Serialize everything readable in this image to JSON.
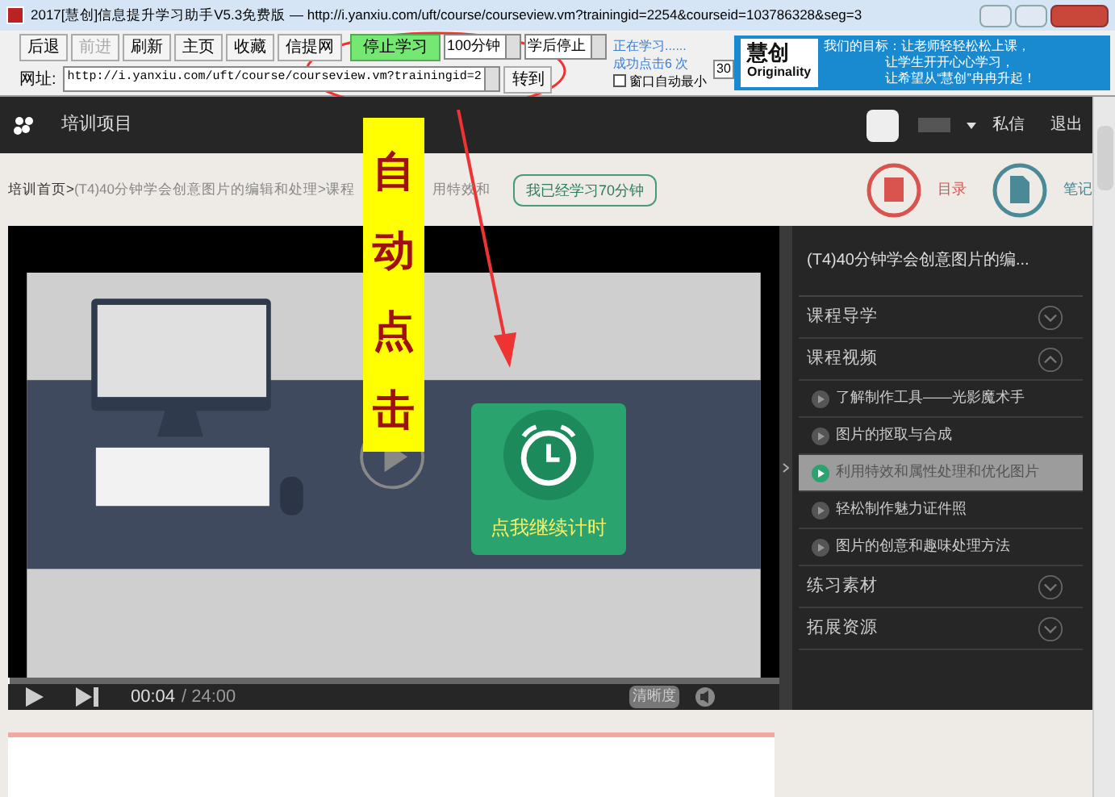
{
  "window": {
    "title": "2017[慧创]信息提升学习助手V5.3免费版 — http://i.yanxiu.com/uft/course/courseview.vm?trainingid=2254&courseid=103786328&seg=3"
  },
  "toolbar": {
    "buttons": [
      {
        "label": "后退",
        "disabled": false
      },
      {
        "label": "前进",
        "disabled": true
      },
      {
        "label": "刷新",
        "disabled": false
      },
      {
        "label": "主页",
        "disabled": false
      },
      {
        "label": "收藏",
        "disabled": false
      },
      {
        "label": "信提网",
        "disabled": false
      }
    ],
    "stop_button": "停止学习",
    "duration_select": "100分钟",
    "after_select": "学后停止",
    "status_lines": [
      "正在学习......",
      "成功点击6 次"
    ],
    "auto_minimize": {
      "label": "窗口自动最小",
      "checked": false
    },
    "interval": "30",
    "address_label": "网址:",
    "address": "http://i.yanxiu.com/uft/course/courseview.vm?trainingid=2",
    "go_button": "转到"
  },
  "banner": {
    "logo": "慧创",
    "logo_sub": "Originality",
    "slogan": [
      "我们的目标：让老师轻轻松松上课，",
      "让学生开开心心学习，",
      "让希望从“慧创”冉冉升起！"
    ]
  },
  "site_header": {
    "title": "培训项目",
    "links": [
      "私信",
      "退出"
    ]
  },
  "breadcrumb": [
    "培训首页>",
    "(T4)40分钟学会创意图片的编辑和处理>",
    "课程",
    "用特效和"
  ],
  "study_badge": "我已经学习70分钟",
  "actions": [
    {
      "kind": "catalog",
      "label": "目录"
    },
    {
      "kind": "notes",
      "label": "笔记"
    }
  ],
  "popup": {
    "label": "点我继续计时"
  },
  "player": {
    "current": "00:04",
    "total": "/ 24:00",
    "quality": "清晰度",
    "level": 0.003
  },
  "sidebar": {
    "title": "(T4)40分钟学会创意图片的编...",
    "sections": [
      {
        "label": "课程导学",
        "expanded": false
      },
      {
        "label": "课程视频",
        "expanded": true,
        "children": [
          {
            "label": "了解制作工具——光影魔术手",
            "selected": false
          },
          {
            "label": "图片的抠取与合成",
            "selected": false
          },
          {
            "label": "利用特效和属性处理和优化图片",
            "selected": true
          },
          {
            "label": "轻松制作魅力证件照",
            "selected": false
          },
          {
            "label": "图片的创意和趣味处理方法",
            "selected": false
          }
        ]
      },
      {
        "label": "练习素材",
        "expanded": false
      },
      {
        "label": "拓展资源",
        "expanded": false
      }
    ]
  },
  "annotation": {
    "label": "自动点击"
  }
}
